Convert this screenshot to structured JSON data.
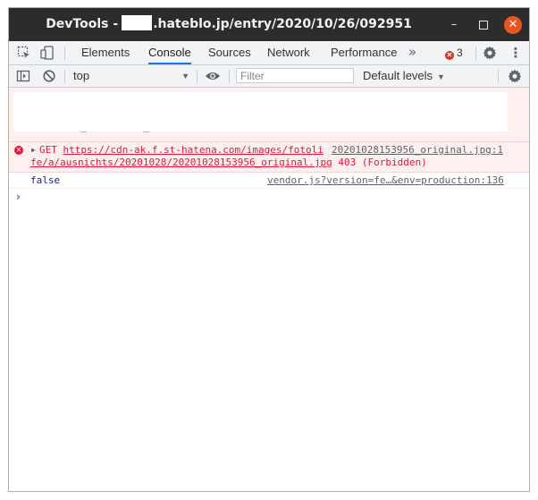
{
  "window": {
    "title_prefix": "DevTools -",
    "title_suffix": ".hateblo.jp/entry/2020/10/26/092951",
    "minimize_glyph": "–",
    "close_glyph": "✕"
  },
  "tabs": {
    "items": [
      {
        "label": "Elements",
        "active": false
      },
      {
        "label": "Console",
        "active": true
      },
      {
        "label": "Sources",
        "active": false
      },
      {
        "label": "Network",
        "active": false
      },
      {
        "label": "Performance",
        "active": false
      }
    ],
    "more_glyph": "»",
    "error_count": "3",
    "error_glyph": "✕",
    "settings_icon": "gear-icon",
    "menu_glyph": "⋮"
  },
  "console_toolbar": {
    "context_value": "top",
    "context_arrow": "▼",
    "filter_placeholder": "Filter",
    "levels_label": "Default levels",
    "levels_arrow": "▼"
  },
  "messages": {
    "error": {
      "glyph": "✕",
      "expander": "▶",
      "method": "GET",
      "url_part1": "https://cdn-ak.f.st-hatena.com/images/fotoli",
      "url_part2": "fe/a/ausnichts/20201028/20201028153956_original.jpg",
      "status": "403 (Forbidden)",
      "source": "20201028153956_original.jpg:1"
    },
    "log": {
      "value": "false",
      "source": "vendor.js?version=fe…&env=production:136"
    },
    "prompt_glyph": "›"
  },
  "colors": {
    "titlebar": "#2c2c2c",
    "close_button": "#e95420",
    "active_tab_underline": "#1a73e8",
    "error_text": "#e4163a",
    "error_background": "#fff0f0"
  }
}
